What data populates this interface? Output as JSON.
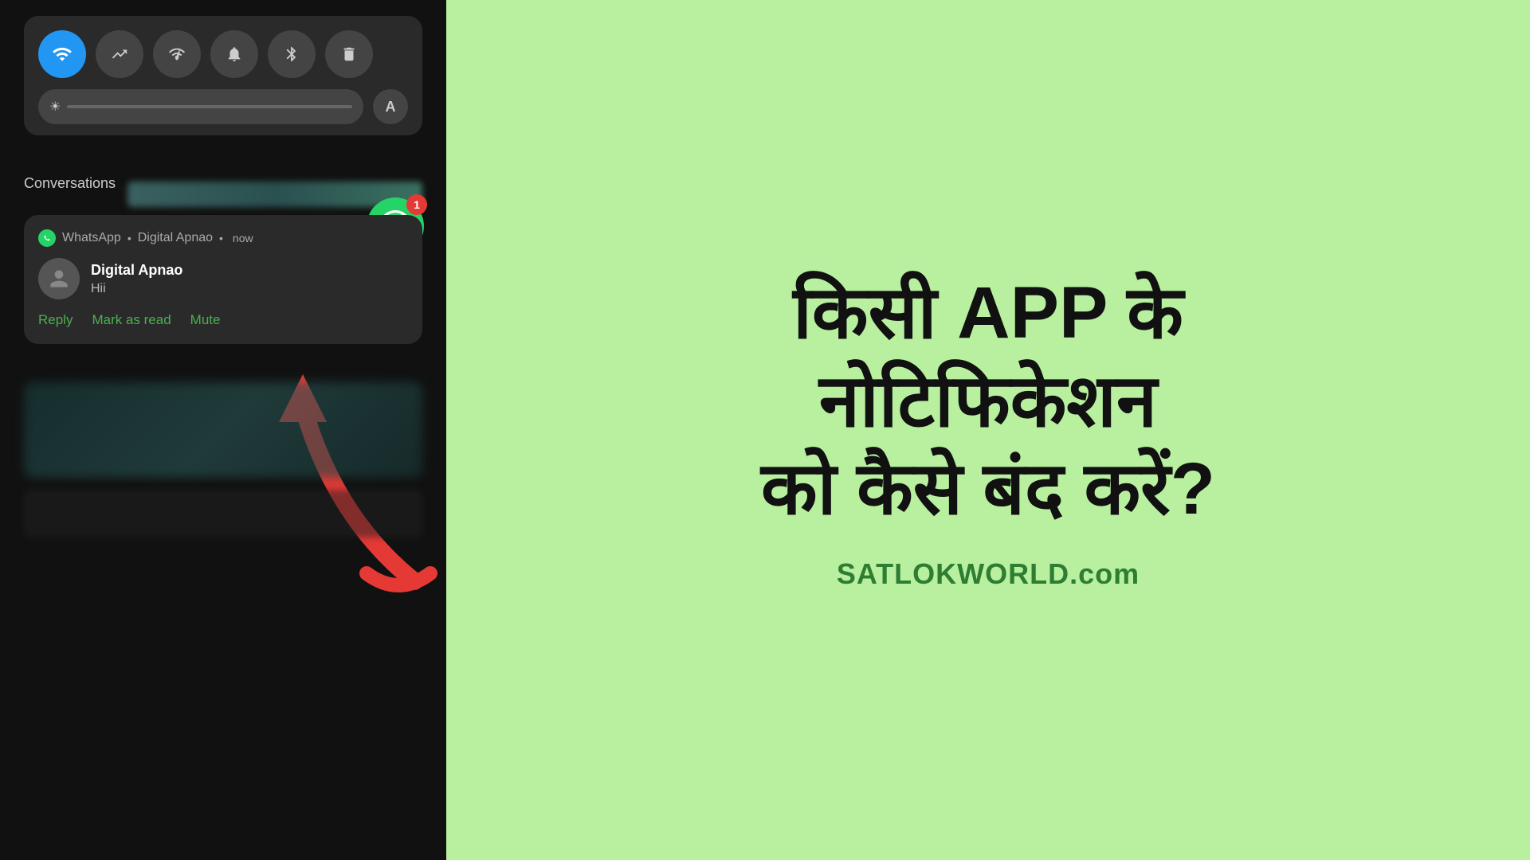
{
  "left": {
    "quickSettings": {
      "icons": [
        {
          "name": "wifi-icon",
          "symbol": "📶",
          "active": true
        },
        {
          "name": "data-icon",
          "symbol": "⇅",
          "active": false
        },
        {
          "name": "hotspot-icon",
          "symbol": "📡",
          "active": false
        },
        {
          "name": "bell-icon",
          "symbol": "🔔",
          "active": false
        },
        {
          "name": "bluetooth-icon",
          "symbol": "⚡",
          "active": false
        },
        {
          "name": "trash-icon",
          "symbol": "🗑",
          "active": false
        }
      ],
      "brightness_label": "brightness",
      "a_button_label": "A"
    },
    "conversationsLabel": "Conversations",
    "notification": {
      "app": "WhatsApp",
      "chat": "Digital Apnao",
      "time": "now",
      "sender": "Digital Apnao",
      "message": "Hii",
      "actions": {
        "reply": "Reply",
        "mark_as_read": "Mark as read",
        "mute": "Mute"
      },
      "badge_count": "1"
    }
  },
  "right": {
    "line1": "किसी APP के",
    "line2": "नोटिफिकेशन",
    "line3": "को कैसे बंद करें?",
    "brand": "SATLOKWORLD.com"
  }
}
